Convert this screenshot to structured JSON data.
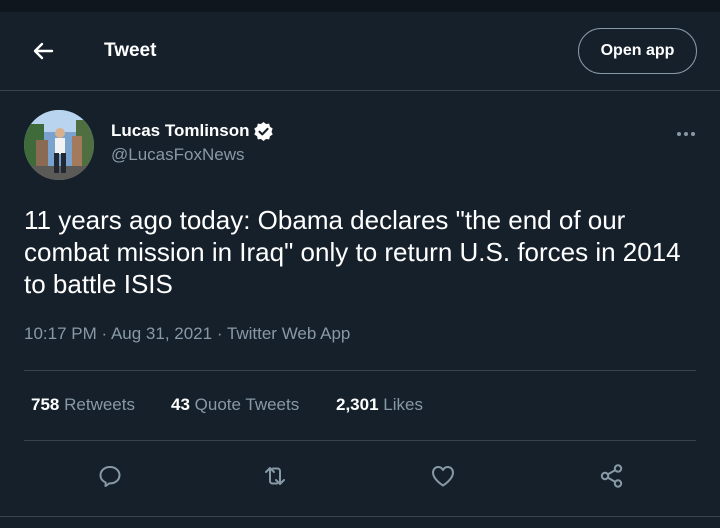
{
  "header": {
    "title": "Tweet",
    "open_app_label": "Open app"
  },
  "author": {
    "name": "Lucas Tomlinson",
    "handle": "@LucasFoxNews",
    "verified": true
  },
  "tweet": {
    "text": "11 years ago today: Obama declares \"the end of our combat mission in Iraq\" only to return U.S. forces in 2014 to battle ISIS",
    "time": "10:17 PM",
    "date": "Aug 31, 2021",
    "source": "Twitter Web App",
    "separator": " · "
  },
  "stats": {
    "retweets": {
      "count": "758",
      "label": "Retweets"
    },
    "quote_tweets": {
      "count": "43",
      "label": "Quote Tweets"
    },
    "likes": {
      "count": "2,301",
      "label": "Likes"
    }
  },
  "icons": {
    "back": "arrow-left-icon",
    "verified": "verified-badge-icon",
    "more": "more-horizontal-icon",
    "reply": "reply-icon",
    "retweet": "retweet-icon",
    "like": "heart-icon",
    "share": "share-icon"
  },
  "colors": {
    "background": "#15202b",
    "text_primary": "#ffffff",
    "text_secondary": "#8899a6",
    "divider": "#38444d",
    "icon": "#8899a6"
  }
}
